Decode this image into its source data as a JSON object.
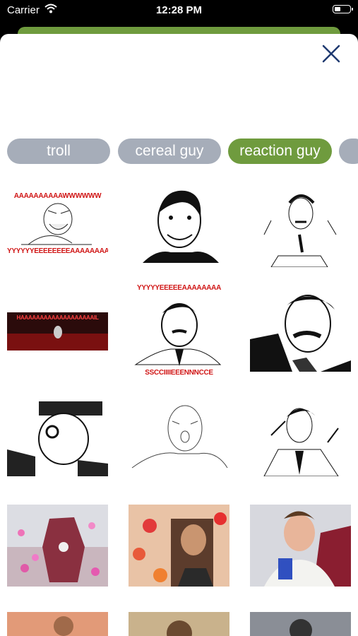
{
  "status_bar": {
    "carrier": "Carrier",
    "time": "12:28 PM"
  },
  "header": {
    "close_icon": "close-x-icon"
  },
  "categories": [
    {
      "label": "troll",
      "active": false
    },
    {
      "label": "cereal guy",
      "active": false
    },
    {
      "label": "reaction guy",
      "active": true
    }
  ],
  "colors": {
    "accent": "#6f9b3e",
    "chip": "#a6adb9",
    "caption_red": "#d01515"
  },
  "memes": {
    "m1_top": "AAAAAAAAAAWWWWWW",
    "m1_bottom": "YYYYYYEEEEEEEEAAAAAAAAAA",
    "m4_text": "HAAAAAAAAAAAAAAAAAAAIL",
    "m5_top": "YYYYYEEEEEAAAAAAAA",
    "m5_bottom": "SSCCIIIIEEENNNCCE"
  }
}
